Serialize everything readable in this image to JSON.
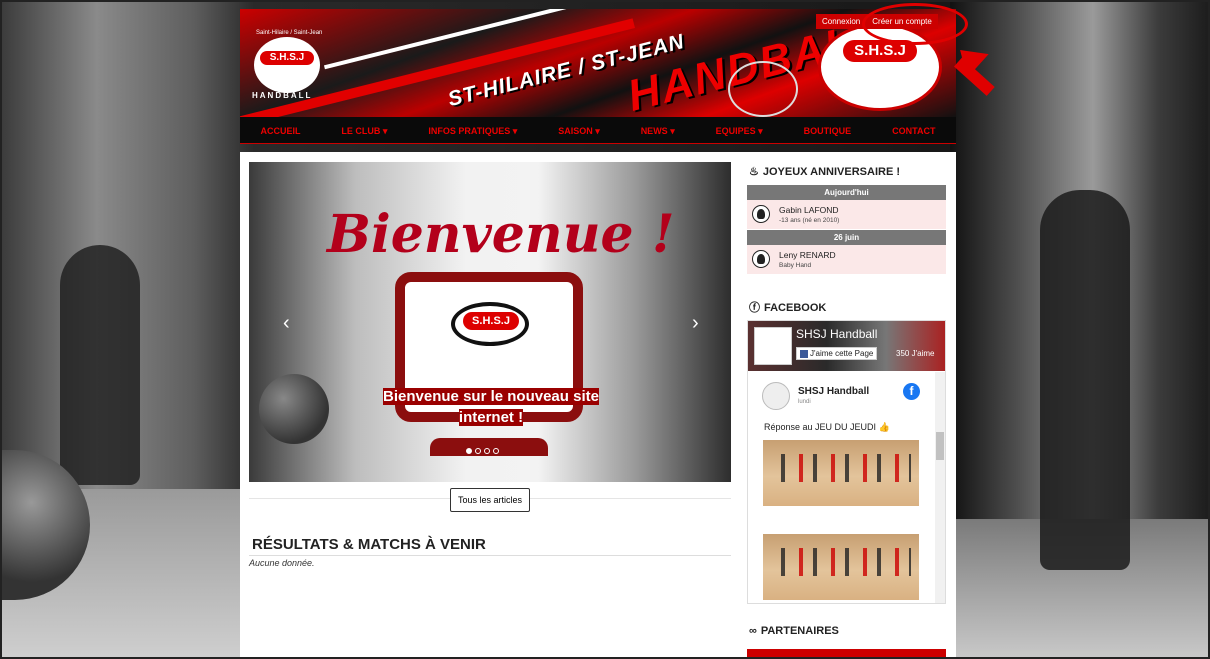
{
  "header": {
    "logo_top": "Saint-Hilaire / Saint-Jean",
    "logo_text": "S.H.S.J",
    "logo_sub": "HANDBALL",
    "title_line1": "ST-HILAIRE / ST-JEAN",
    "title_line2": "HANDBALL",
    "auth": {
      "login": "Connexion",
      "register": "Créer un compte"
    }
  },
  "nav": {
    "items": [
      "ACCUEIL",
      "LE CLUB ▾",
      "INFOS PRATIQUES ▾",
      "SAISON ▾",
      "NEWS ▾",
      "EQUIPES ▾",
      "BOUTIQUE",
      "CONTACT"
    ]
  },
  "slider": {
    "title": "Bienvenue !",
    "logo_text": "S.H.S.J",
    "caption_line1": "Bienvenue sur le nouveau site",
    "caption_line2": "internet !",
    "prev": "‹",
    "next": "›",
    "dot_count": 4,
    "active_dot": 0
  },
  "articles_button": "Tous les articles",
  "results": {
    "title": "RÉSULTATS & MATCHS À VENIR",
    "empty": "Aucune donnée."
  },
  "birthdays": {
    "title": "JOYEUX ANNIVERSAIRE !",
    "groups": [
      {
        "day": "Aujourd'hui",
        "name": "Gabin LAFOND",
        "detail": "-13 ans (né en 2010)"
      },
      {
        "day": "26 juin",
        "name": "Leny RENARD",
        "detail": "Baby Hand"
      }
    ]
  },
  "facebook": {
    "title": "FACEBOOK",
    "page_name": "SHSJ Handball",
    "like_label": "J'aime cette Page",
    "like_count": "350 J'aime",
    "post_author": "SHSJ Handball",
    "post_date": "lundi",
    "post_text": "Réponse au JEU DU JEUDI 👍"
  },
  "partners": {
    "title": "PARTENAIRES"
  },
  "colors": {
    "brand_red": "#e00000",
    "dark": "#0a0a0a"
  },
  "icons": {
    "birthday": "cake-icon",
    "facebook": "facebook-icon",
    "partners": "link-icon"
  }
}
